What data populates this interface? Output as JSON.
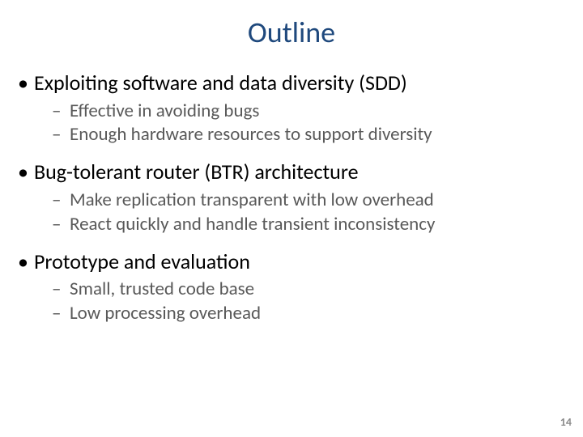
{
  "title": "Outline",
  "bullets": [
    {
      "text": "Exploiting software and data diversity (SDD)",
      "children": [
        "Effective in avoiding bugs",
        "Enough hardware resources to support diversity"
      ]
    },
    {
      "text": "Bug-tolerant router (BTR) architecture",
      "children": [
        "Make replication transparent with low overhead",
        "React quickly and handle transient inconsistency"
      ]
    },
    {
      "text": "Prototype and evaluation",
      "children": [
        "Small, trusted code base",
        "Low processing overhead"
      ]
    }
  ],
  "page_number": "14"
}
